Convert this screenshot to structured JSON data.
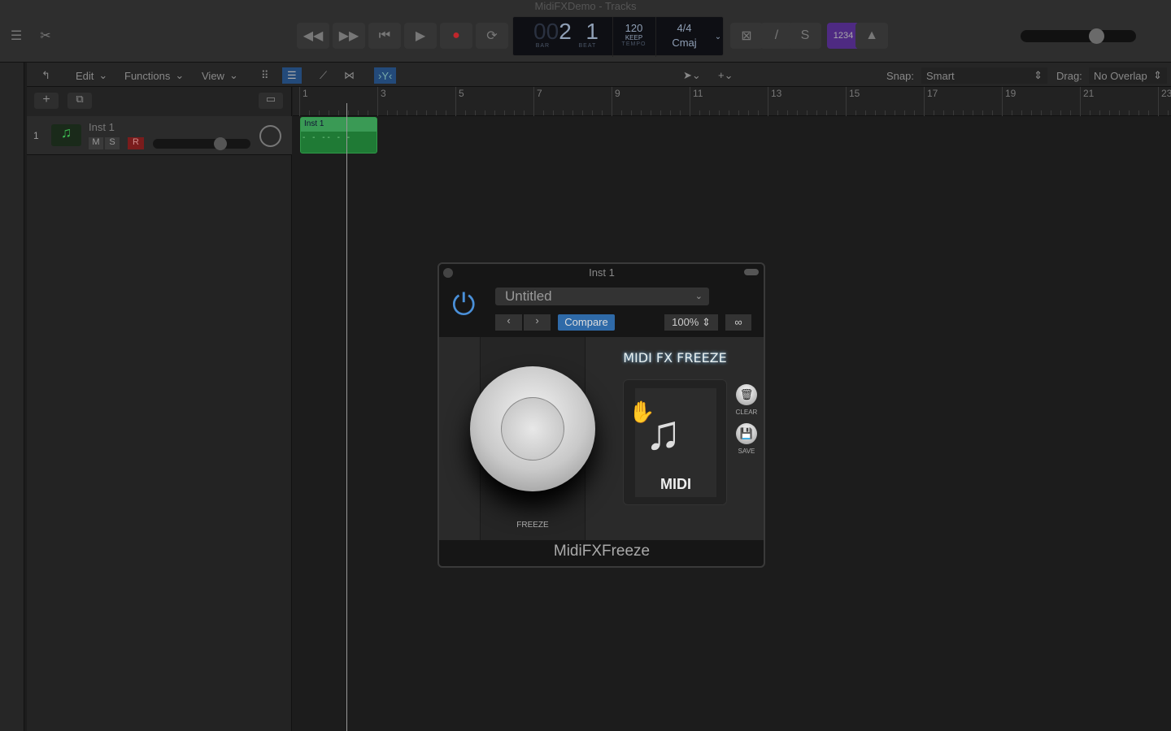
{
  "window": {
    "title": "MidiFXDemo - Tracks"
  },
  "transport": {
    "bar_prefix": "00",
    "bar": "2",
    "beat": "1",
    "bar_label": "BAR",
    "beat_label": "BEAT",
    "tempo": "120",
    "tempo_mode": "KEEP",
    "tempo_label": "TEMPO",
    "signature": "4/4",
    "key": "Cmaj",
    "count_in": "1234"
  },
  "menubar": {
    "edit": "Edit",
    "functions": "Functions",
    "view": "View",
    "snap_label": "Snap:",
    "snap_value": "Smart",
    "drag_label": "Drag:",
    "drag_value": "No Overlap"
  },
  "ruler": {
    "bars": [
      "1",
      "3",
      "5",
      "7",
      "9",
      "11",
      "13",
      "15",
      "17",
      "19",
      "21",
      "23"
    ]
  },
  "track": {
    "number": "1",
    "name": "Inst 1",
    "mute": "M",
    "solo": "S",
    "record": "R",
    "volume_fraction": 0.72
  },
  "region": {
    "name": "Inst 1"
  },
  "master_volume_fraction": 0.68,
  "plugin": {
    "title": "Inst 1",
    "preset": "Untitled",
    "compare": "Compare",
    "zoom": "100%",
    "brand": "MIDI FX FREEZE",
    "freeze_label": "FREEZE",
    "file_label": "MIDI",
    "clear_label": "CLEAR",
    "save_label": "SAVE",
    "footer": "MidiFXFreeze",
    "accent": "#4a90d9"
  }
}
